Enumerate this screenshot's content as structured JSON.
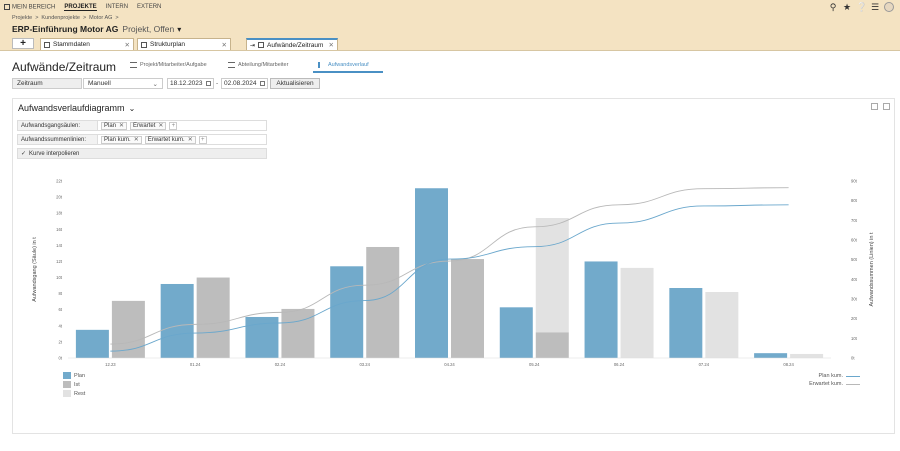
{
  "nav": {
    "items": [
      "MEIN BEREICH",
      "PROJEKTE",
      "INTERN",
      "EXTERN"
    ],
    "active": "PROJEKTE"
  },
  "breadcrumb": [
    "Projekte",
    ">",
    "Kundenprojekte",
    ">",
    "Motor AG",
    ">"
  ],
  "project": {
    "name": "ERP-Einführung Motor AG",
    "status": "Projekt, Offen"
  },
  "header_icons": [
    "search-icon",
    "star-icon",
    "help-icon",
    "menu-icon",
    "avatar"
  ],
  "tabs": [
    {
      "label": "Stammdaten",
      "icon": "folder-icon"
    },
    {
      "label": "Strukturplan",
      "icon": "document-icon"
    },
    {
      "label": "Aufwände/Zeitraum",
      "icon": "chart-icon"
    }
  ],
  "page": {
    "title": "Aufwände/Zeitraum",
    "views": [
      {
        "label": "Projekt/Mitarbeiter/Aufgabe"
      },
      {
        "label": "Abteilung/Mitarbeiter"
      },
      {
        "label": "Aufwandsverlauf"
      }
    ]
  },
  "filter": {
    "label": "Zeitraum",
    "mode": "Manuell",
    "date_from": "18.12.2023",
    "separator": "-",
    "date_to": "02.08.2024",
    "button": "Aktualisieren"
  },
  "panel": {
    "title": "Aufwandsverlaufdiagramm",
    "columns_label": "Aufwandsgangsäulen:",
    "columns": [
      "Plan",
      "Erwartet"
    ],
    "lines_label": "Aufwandssummenlinien:",
    "lines": [
      "Plan kum.",
      "Erwartet kum."
    ],
    "interpolate": "Kurve interpolieren"
  },
  "colors": {
    "plan": "#72aacb",
    "ist": "#bdbdbd",
    "rest": "#e2e2e2",
    "line_plan": "#6aa7cc",
    "line_erw": "#b8b8b8",
    "accent": "#4a90c4",
    "header": "#f4e3c2"
  },
  "chart_data": {
    "type": "bar",
    "categories": [
      "12.23",
      "01.24",
      "02.24",
      "03.24",
      "04.24",
      "05.24",
      "06.24",
      "07.24",
      "08.24"
    ],
    "series": [
      {
        "name": "Plan",
        "values": [
          3.5,
          9.2,
          5.1,
          11.4,
          21.1,
          6.3,
          12.0,
          8.7,
          0.6
        ]
      },
      {
        "name": "Ist",
        "values": [
          7.1,
          10.0,
          6.1,
          13.8,
          12.3,
          3.2,
          0,
          0,
          0
        ]
      },
      {
        "name": "Rest",
        "values": [
          0,
          0,
          0,
          0,
          0,
          14.2,
          11.2,
          8.2,
          0.5
        ]
      }
    ],
    "lines": [
      {
        "name": "Plan kum.",
        "values": [
          3.5,
          12.7,
          17.8,
          29.2,
          50.3,
          56.6,
          68.6,
          77.3,
          77.9
        ]
      },
      {
        "name": "Erwartet kum.",
        "values": [
          7.1,
          17.1,
          23.2,
          37.0,
          49.3,
          66.7,
          77.9,
          86.1,
          86.6
        ]
      }
    ],
    "ylabel": "Aufwandsgang (Säule) in t",
    "y2label": "Aufwandssummen (Linien) in t",
    "ylim": [
      0,
      22
    ],
    "y2lim": [
      0,
      90
    ],
    "yticks": [
      "0t",
      "2t",
      "4t",
      "6t",
      "8t",
      "10t",
      "12t",
      "14t",
      "16t",
      "18t",
      "20t",
      "22t"
    ],
    "y2ticks": [
      "0t",
      "10t",
      "20t",
      "30t",
      "40t",
      "50t",
      "60t",
      "70t",
      "80t",
      "90t"
    ],
    "legend": [
      "Plan",
      "Ist",
      "Rest"
    ],
    "line_legend": [
      "Plan kum.",
      "Erwartet kum."
    ],
    "grid": false
  }
}
